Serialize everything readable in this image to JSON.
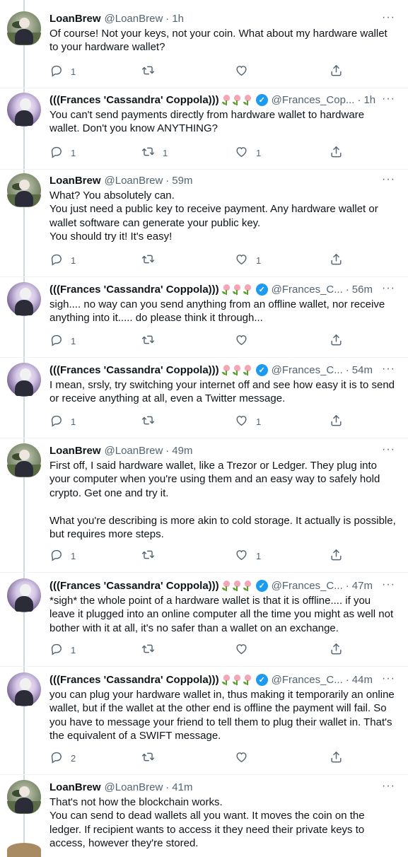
{
  "tweets": [
    {
      "author": "LoanBrew",
      "handle": "@LoanBrew",
      "time": "1h",
      "avatar": "loanbrew",
      "text": "Of course! Not your keys, not your coin. What about my hardware wallet to your hardware wallet?",
      "replies": "1",
      "retweets": "",
      "likes": ""
    },
    {
      "author": "(((Frances 'Cassandra' Coppola)))",
      "handle": "@Frances_Cop...",
      "time": "1h",
      "avatar": "frances",
      "emoji": "tulip-tulip-tulip",
      "verified": true,
      "text": "You can't send payments directly from hardware wallet to hardware wallet. Don't you know ANYTHING?",
      "replies": "1",
      "retweets": "1",
      "likes": "1"
    },
    {
      "author": "LoanBrew",
      "handle": "@LoanBrew",
      "time": "59m",
      "avatar": "loanbrew",
      "text": "What? You absolutely can.\nYou just need a public key to receive payment. Any hardware wallet or wallet software can generate your public key.\nYou should try it! It's easy!",
      "replies": "1",
      "retweets": "",
      "likes": "1"
    },
    {
      "author": "(((Frances 'Cassandra' Coppola)))",
      "handle": "@Frances_C...",
      "time": "56m",
      "avatar": "frances",
      "emoji": "tulip-tulip-tulip",
      "verified": true,
      "text": "sigh.... no way can you send anything from an offline wallet, nor receive anything into it..... do please think it through...",
      "replies": "1",
      "retweets": "",
      "likes": ""
    },
    {
      "author": "(((Frances 'Cassandra' Coppola)))",
      "handle": "@Frances_C...",
      "time": "54m",
      "avatar": "frances",
      "emoji": "tulip-tulip-tulip",
      "verified": true,
      "text": "I mean, srsly, try switching your internet off and see how easy it is to send or receive anything at all, even a Twitter message.",
      "replies": "1",
      "retweets": "",
      "likes": "1"
    },
    {
      "author": "LoanBrew",
      "handle": "@LoanBrew",
      "time": "49m",
      "avatar": "loanbrew",
      "text": "First off, I said hardware wallet, like a Trezor or Ledger. They plug into your computer when you're using them and an easy way to safely hold crypto. Get one and try it.\n\nWhat you're describing is more akin to cold storage. It actually is possible, but requires more steps.",
      "replies": "1",
      "retweets": "",
      "likes": "1"
    },
    {
      "author": "(((Frances 'Cassandra' Coppola)))",
      "handle": "@Frances_C...",
      "time": "47m",
      "avatar": "frances",
      "emoji": "tulip-tulip-tulip",
      "verified": true,
      "text": "*sigh* the whole point of a hardware wallet is that it is offline.... if you leave it plugged into an online computer all the time you might as well not bother with it at all, it's no safer than a wallet on an exchange.",
      "replies": "1",
      "retweets": "",
      "likes": ""
    },
    {
      "author": "(((Frances 'Cassandra' Coppola)))",
      "handle": "@Frances_C...",
      "time": "44m",
      "avatar": "frances",
      "emoji": "tulip-tulip-tulip",
      "verified": true,
      "text": "you can plug your hardware wallet in, thus making it temporarily an online wallet, but if the wallet at the other end is offline the payment will fail. So you have to message your friend to tell them to plug their wallet in. That's the equivalent of a SWIFT message.",
      "replies": "2",
      "retweets": "",
      "likes": ""
    },
    {
      "author": "LoanBrew",
      "handle": "@LoanBrew",
      "time": "41m",
      "avatar": "loanbrew",
      "text": "That's not how the blockchain works.\nYou can send to dead wallets all you want. It moves the coin on the ledger. If recipient wants to access it they need their private keys to access, however they're stored.",
      "replies": "",
      "retweets": "",
      "likes": ""
    }
  ],
  "more_menu": "···"
}
